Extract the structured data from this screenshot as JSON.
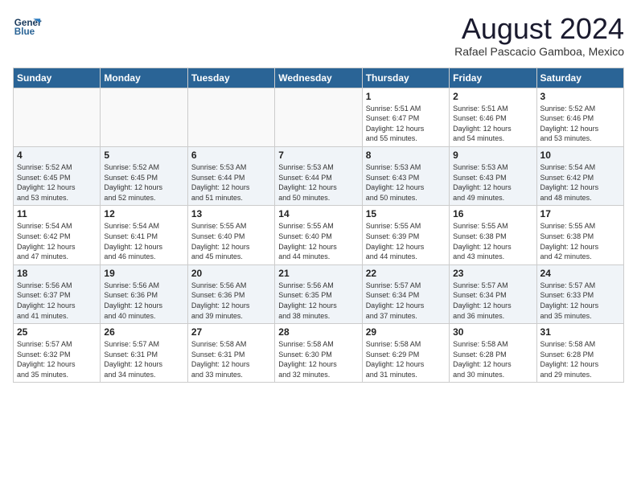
{
  "header": {
    "logo_line1": "General",
    "logo_line2": "Blue",
    "title": "August 2024",
    "location": "Rafael Pascacio Gamboa, Mexico"
  },
  "weekdays": [
    "Sunday",
    "Monday",
    "Tuesday",
    "Wednesday",
    "Thursday",
    "Friday",
    "Saturday"
  ],
  "weeks": [
    [
      {
        "day": "",
        "info": ""
      },
      {
        "day": "",
        "info": ""
      },
      {
        "day": "",
        "info": ""
      },
      {
        "day": "",
        "info": ""
      },
      {
        "day": "1",
        "info": "Sunrise: 5:51 AM\nSunset: 6:47 PM\nDaylight: 12 hours\nand 55 minutes."
      },
      {
        "day": "2",
        "info": "Sunrise: 5:51 AM\nSunset: 6:46 PM\nDaylight: 12 hours\nand 54 minutes."
      },
      {
        "day": "3",
        "info": "Sunrise: 5:52 AM\nSunset: 6:46 PM\nDaylight: 12 hours\nand 53 minutes."
      }
    ],
    [
      {
        "day": "4",
        "info": "Sunrise: 5:52 AM\nSunset: 6:45 PM\nDaylight: 12 hours\nand 53 minutes."
      },
      {
        "day": "5",
        "info": "Sunrise: 5:52 AM\nSunset: 6:45 PM\nDaylight: 12 hours\nand 52 minutes."
      },
      {
        "day": "6",
        "info": "Sunrise: 5:53 AM\nSunset: 6:44 PM\nDaylight: 12 hours\nand 51 minutes."
      },
      {
        "day": "7",
        "info": "Sunrise: 5:53 AM\nSunset: 6:44 PM\nDaylight: 12 hours\nand 50 minutes."
      },
      {
        "day": "8",
        "info": "Sunrise: 5:53 AM\nSunset: 6:43 PM\nDaylight: 12 hours\nand 50 minutes."
      },
      {
        "day": "9",
        "info": "Sunrise: 5:53 AM\nSunset: 6:43 PM\nDaylight: 12 hours\nand 49 minutes."
      },
      {
        "day": "10",
        "info": "Sunrise: 5:54 AM\nSunset: 6:42 PM\nDaylight: 12 hours\nand 48 minutes."
      }
    ],
    [
      {
        "day": "11",
        "info": "Sunrise: 5:54 AM\nSunset: 6:42 PM\nDaylight: 12 hours\nand 47 minutes."
      },
      {
        "day": "12",
        "info": "Sunrise: 5:54 AM\nSunset: 6:41 PM\nDaylight: 12 hours\nand 46 minutes."
      },
      {
        "day": "13",
        "info": "Sunrise: 5:55 AM\nSunset: 6:40 PM\nDaylight: 12 hours\nand 45 minutes."
      },
      {
        "day": "14",
        "info": "Sunrise: 5:55 AM\nSunset: 6:40 PM\nDaylight: 12 hours\nand 44 minutes."
      },
      {
        "day": "15",
        "info": "Sunrise: 5:55 AM\nSunset: 6:39 PM\nDaylight: 12 hours\nand 44 minutes."
      },
      {
        "day": "16",
        "info": "Sunrise: 5:55 AM\nSunset: 6:38 PM\nDaylight: 12 hours\nand 43 minutes."
      },
      {
        "day": "17",
        "info": "Sunrise: 5:55 AM\nSunset: 6:38 PM\nDaylight: 12 hours\nand 42 minutes."
      }
    ],
    [
      {
        "day": "18",
        "info": "Sunrise: 5:56 AM\nSunset: 6:37 PM\nDaylight: 12 hours\nand 41 minutes."
      },
      {
        "day": "19",
        "info": "Sunrise: 5:56 AM\nSunset: 6:36 PM\nDaylight: 12 hours\nand 40 minutes."
      },
      {
        "day": "20",
        "info": "Sunrise: 5:56 AM\nSunset: 6:36 PM\nDaylight: 12 hours\nand 39 minutes."
      },
      {
        "day": "21",
        "info": "Sunrise: 5:56 AM\nSunset: 6:35 PM\nDaylight: 12 hours\nand 38 minutes."
      },
      {
        "day": "22",
        "info": "Sunrise: 5:57 AM\nSunset: 6:34 PM\nDaylight: 12 hours\nand 37 minutes."
      },
      {
        "day": "23",
        "info": "Sunrise: 5:57 AM\nSunset: 6:34 PM\nDaylight: 12 hours\nand 36 minutes."
      },
      {
        "day": "24",
        "info": "Sunrise: 5:57 AM\nSunset: 6:33 PM\nDaylight: 12 hours\nand 35 minutes."
      }
    ],
    [
      {
        "day": "25",
        "info": "Sunrise: 5:57 AM\nSunset: 6:32 PM\nDaylight: 12 hours\nand 35 minutes."
      },
      {
        "day": "26",
        "info": "Sunrise: 5:57 AM\nSunset: 6:31 PM\nDaylight: 12 hours\nand 34 minutes."
      },
      {
        "day": "27",
        "info": "Sunrise: 5:58 AM\nSunset: 6:31 PM\nDaylight: 12 hours\nand 33 minutes."
      },
      {
        "day": "28",
        "info": "Sunrise: 5:58 AM\nSunset: 6:30 PM\nDaylight: 12 hours\nand 32 minutes."
      },
      {
        "day": "29",
        "info": "Sunrise: 5:58 AM\nSunset: 6:29 PM\nDaylight: 12 hours\nand 31 minutes."
      },
      {
        "day": "30",
        "info": "Sunrise: 5:58 AM\nSunset: 6:28 PM\nDaylight: 12 hours\nand 30 minutes."
      },
      {
        "day": "31",
        "info": "Sunrise: 5:58 AM\nSunset: 6:28 PM\nDaylight: 12 hours\nand 29 minutes."
      }
    ]
  ]
}
